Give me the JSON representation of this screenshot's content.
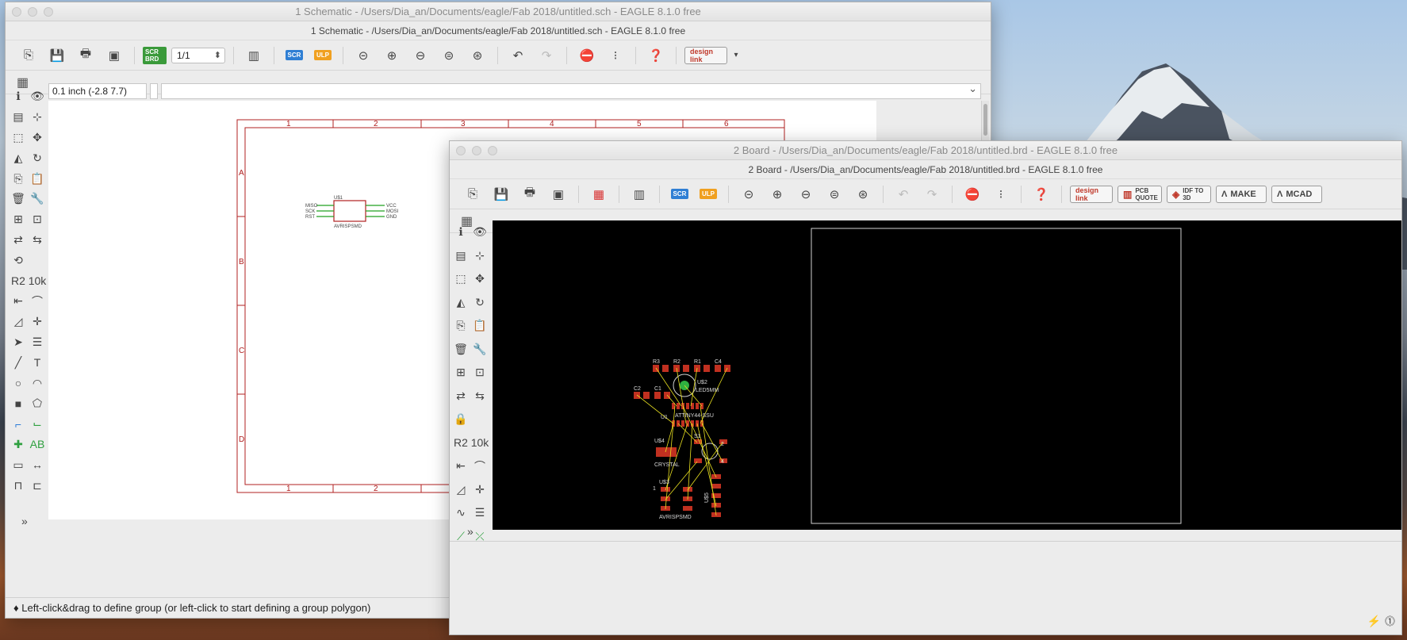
{
  "schematic": {
    "title": "1 Schematic - /Users/Dia_an/Documents/eagle/Fab 2018/untitled.sch - EAGLE 8.1.0 free",
    "subtitle": "1 Schematic - /Users/Dia_an/Documents/eagle/Fab 2018/untitled.sch - EAGLE 8.1.0 free",
    "sheet_value": "1/1",
    "coord_readout": "0.1 inch (-2.8 7.7)",
    "scr_label": "SCR",
    "ulp_label": "ULP",
    "brd_label": "SCR BRD",
    "designlink_label": "design link",
    "frame": {
      "cols_top": [
        "1",
        "2",
        "3",
        "4",
        "5",
        "6"
      ],
      "cols_bottom": [
        "1",
        "2"
      ],
      "rows": [
        "A",
        "B",
        "C",
        "D"
      ]
    },
    "part": {
      "ref": "U$1",
      "name": "AVRISPSMD",
      "left_pins": [
        "MISO",
        "SCK",
        "RST"
      ],
      "right_pins": [
        "VCC",
        "MOSI",
        "GND"
      ]
    },
    "status_text": "Left-click&drag to define group (or left-click to start defining a group polygon)",
    "colors": {
      "frame": "#b02020",
      "net": "#20a020",
      "part": "#b02020"
    }
  },
  "board": {
    "title": "2 Board - /Users/Dia_an/Documents/eagle/Fab 2018/untitled.brd - EAGLE 8.1.0 free",
    "subtitle": "2 Board - /Users/Dia_an/Documents/eagle/Fab 2018/untitled.brd - EAGLE 8.1.0 free",
    "scr_label": "SCR",
    "ulp_label": "ULP",
    "designlink_label": "design link",
    "pcb_quote_label": "PCB QUOTE",
    "idf_label": "IDF TO 3D",
    "make_label": "MAKE",
    "mcad_label": "MCAD",
    "parts": {
      "r3": "R3",
      "r2": "R2",
      "r1": "R1",
      "c4": "C4",
      "c2": "C2",
      "c1": "C1",
      "u2": "U$2",
      "led": "LED5MM",
      "u1_ref": "U1",
      "attiny": "ATTINY44-SSU",
      "u4": "U$4",
      "crystal": "CRYSTAL",
      "s1": "S1",
      "s1_p2": "2",
      "s1_p4": "4",
      "u3": "U$3",
      "pin1": "1",
      "avr": "AVRISPSMD",
      "u5": "U$5"
    },
    "colors": {
      "canvas": "#000000",
      "pad": "#c03020",
      "airwire": "#e8e020",
      "outline": "#cfcfcf",
      "silk": "#d8d8d8"
    }
  }
}
